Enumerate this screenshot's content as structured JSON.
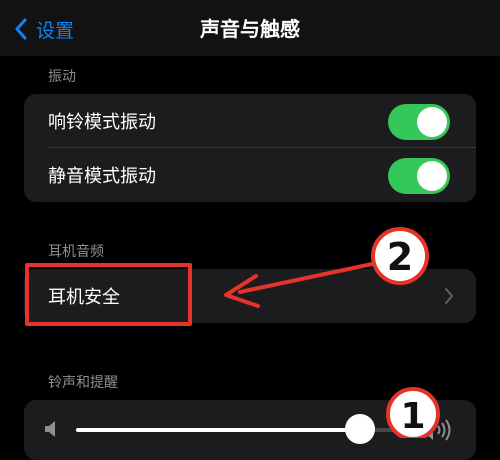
{
  "nav": {
    "back_label": "设置",
    "title": "声音与触感"
  },
  "sections": {
    "vibration": {
      "header": "振动",
      "items": [
        {
          "label": "响铃模式振动",
          "toggle_on": true
        },
        {
          "label": "静音模式振动",
          "toggle_on": true
        }
      ]
    },
    "headphone": {
      "header": "耳机音频",
      "items": [
        {
          "label": "耳机安全"
        }
      ]
    },
    "ringtone": {
      "header": "铃声和提醒",
      "volume_level": 0.85
    }
  },
  "annotations": {
    "marker_2": "2",
    "marker_1": "1",
    "color": "#e4332a"
  },
  "colors": {
    "accent_blue": "#0a84ff",
    "toggle_green": "#34c759"
  }
}
